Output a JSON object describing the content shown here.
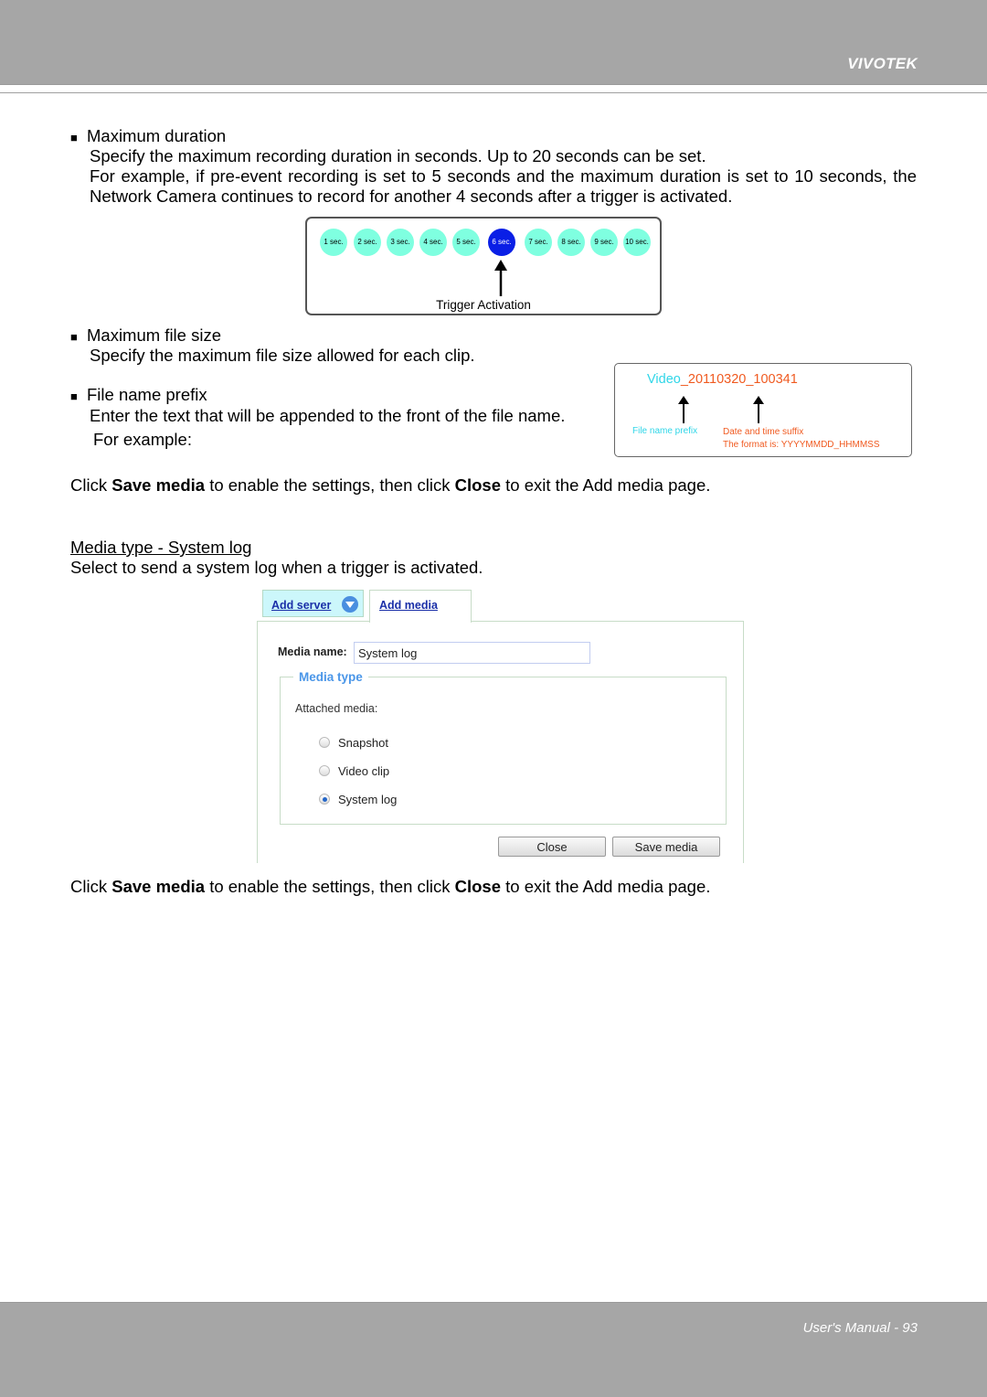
{
  "header": {
    "brand": "VIVOTEK"
  },
  "footer": {
    "page_label": "User's Manual - 93"
  },
  "sections": {
    "max_duration": {
      "bullet": "■",
      "title": "Maximum duration",
      "line1": "Specify the maximum recording duration in seconds. Up to 20 seconds can be set.",
      "line2": "For example, if pre-event recording is set to 5 seconds and the maximum duration is set to 10 seconds, the Network Camera continues to record for another 4 seconds after a trigger is activated."
    },
    "timeline_figure": {
      "steps": [
        "1 sec.",
        "2 sec.",
        "3 sec.",
        "4 sec.",
        "5 sec.",
        "6 sec.",
        "7 sec.",
        "8 sec.",
        "9 sec.",
        "10 sec."
      ],
      "active_index": 5,
      "colors": {
        "inactive": "#7fffe0",
        "active": "#0a1fe6"
      },
      "label": "Trigger Activation"
    },
    "max_file_size": {
      "bullet": "■",
      "title": "Maximum file size",
      "line1": "Specify the maximum file size allowed for each clip."
    },
    "file_name_prefix": {
      "bullet": "■",
      "title": "File name prefix",
      "line1": "Enter the text that will be appended to the front of the file name.",
      "line2": "For example:"
    },
    "filename_figure": {
      "prefix": "Video",
      "suffix": "_20110320_100341",
      "prefix_label": "File name prefix",
      "suffix_label": "Date and time suffix",
      "format_label": "The format is: YYYYMMDD_HHMMSS",
      "colors": {
        "prefix": "#2fd6e8",
        "suffix": "#f05a20"
      }
    },
    "save_note_1": {
      "pre": "Click ",
      "bold1": "Save media",
      "mid": " to enable the settings, then click ",
      "bold2": "Close",
      "post": " to exit the Add media page."
    },
    "media_type_system_log": {
      "heading": "Media type - System log",
      "line1": "Select to send a system log when a trigger is activated."
    },
    "save_note_2": {
      "pre": "Click ",
      "bold1": "Save media",
      "mid": " to enable the settings, then click ",
      "bold2": "Close",
      "post": " to exit the Add media page."
    }
  },
  "ui_screenshot": {
    "tabs": [
      {
        "label": "Add server",
        "icon": "chevron-down-circle-icon"
      },
      {
        "label": "Add media",
        "selected": true
      }
    ],
    "media_name_label": "Media name:",
    "media_name_value": "System log",
    "fieldset_legend": "Media type",
    "attached_label": "Attached media:",
    "options": [
      {
        "label": "Snapshot",
        "checked": false
      },
      {
        "label": "Video clip",
        "checked": false
      },
      {
        "label": "System log",
        "checked": true
      }
    ],
    "buttons": {
      "close": "Close",
      "save": "Save media"
    }
  }
}
